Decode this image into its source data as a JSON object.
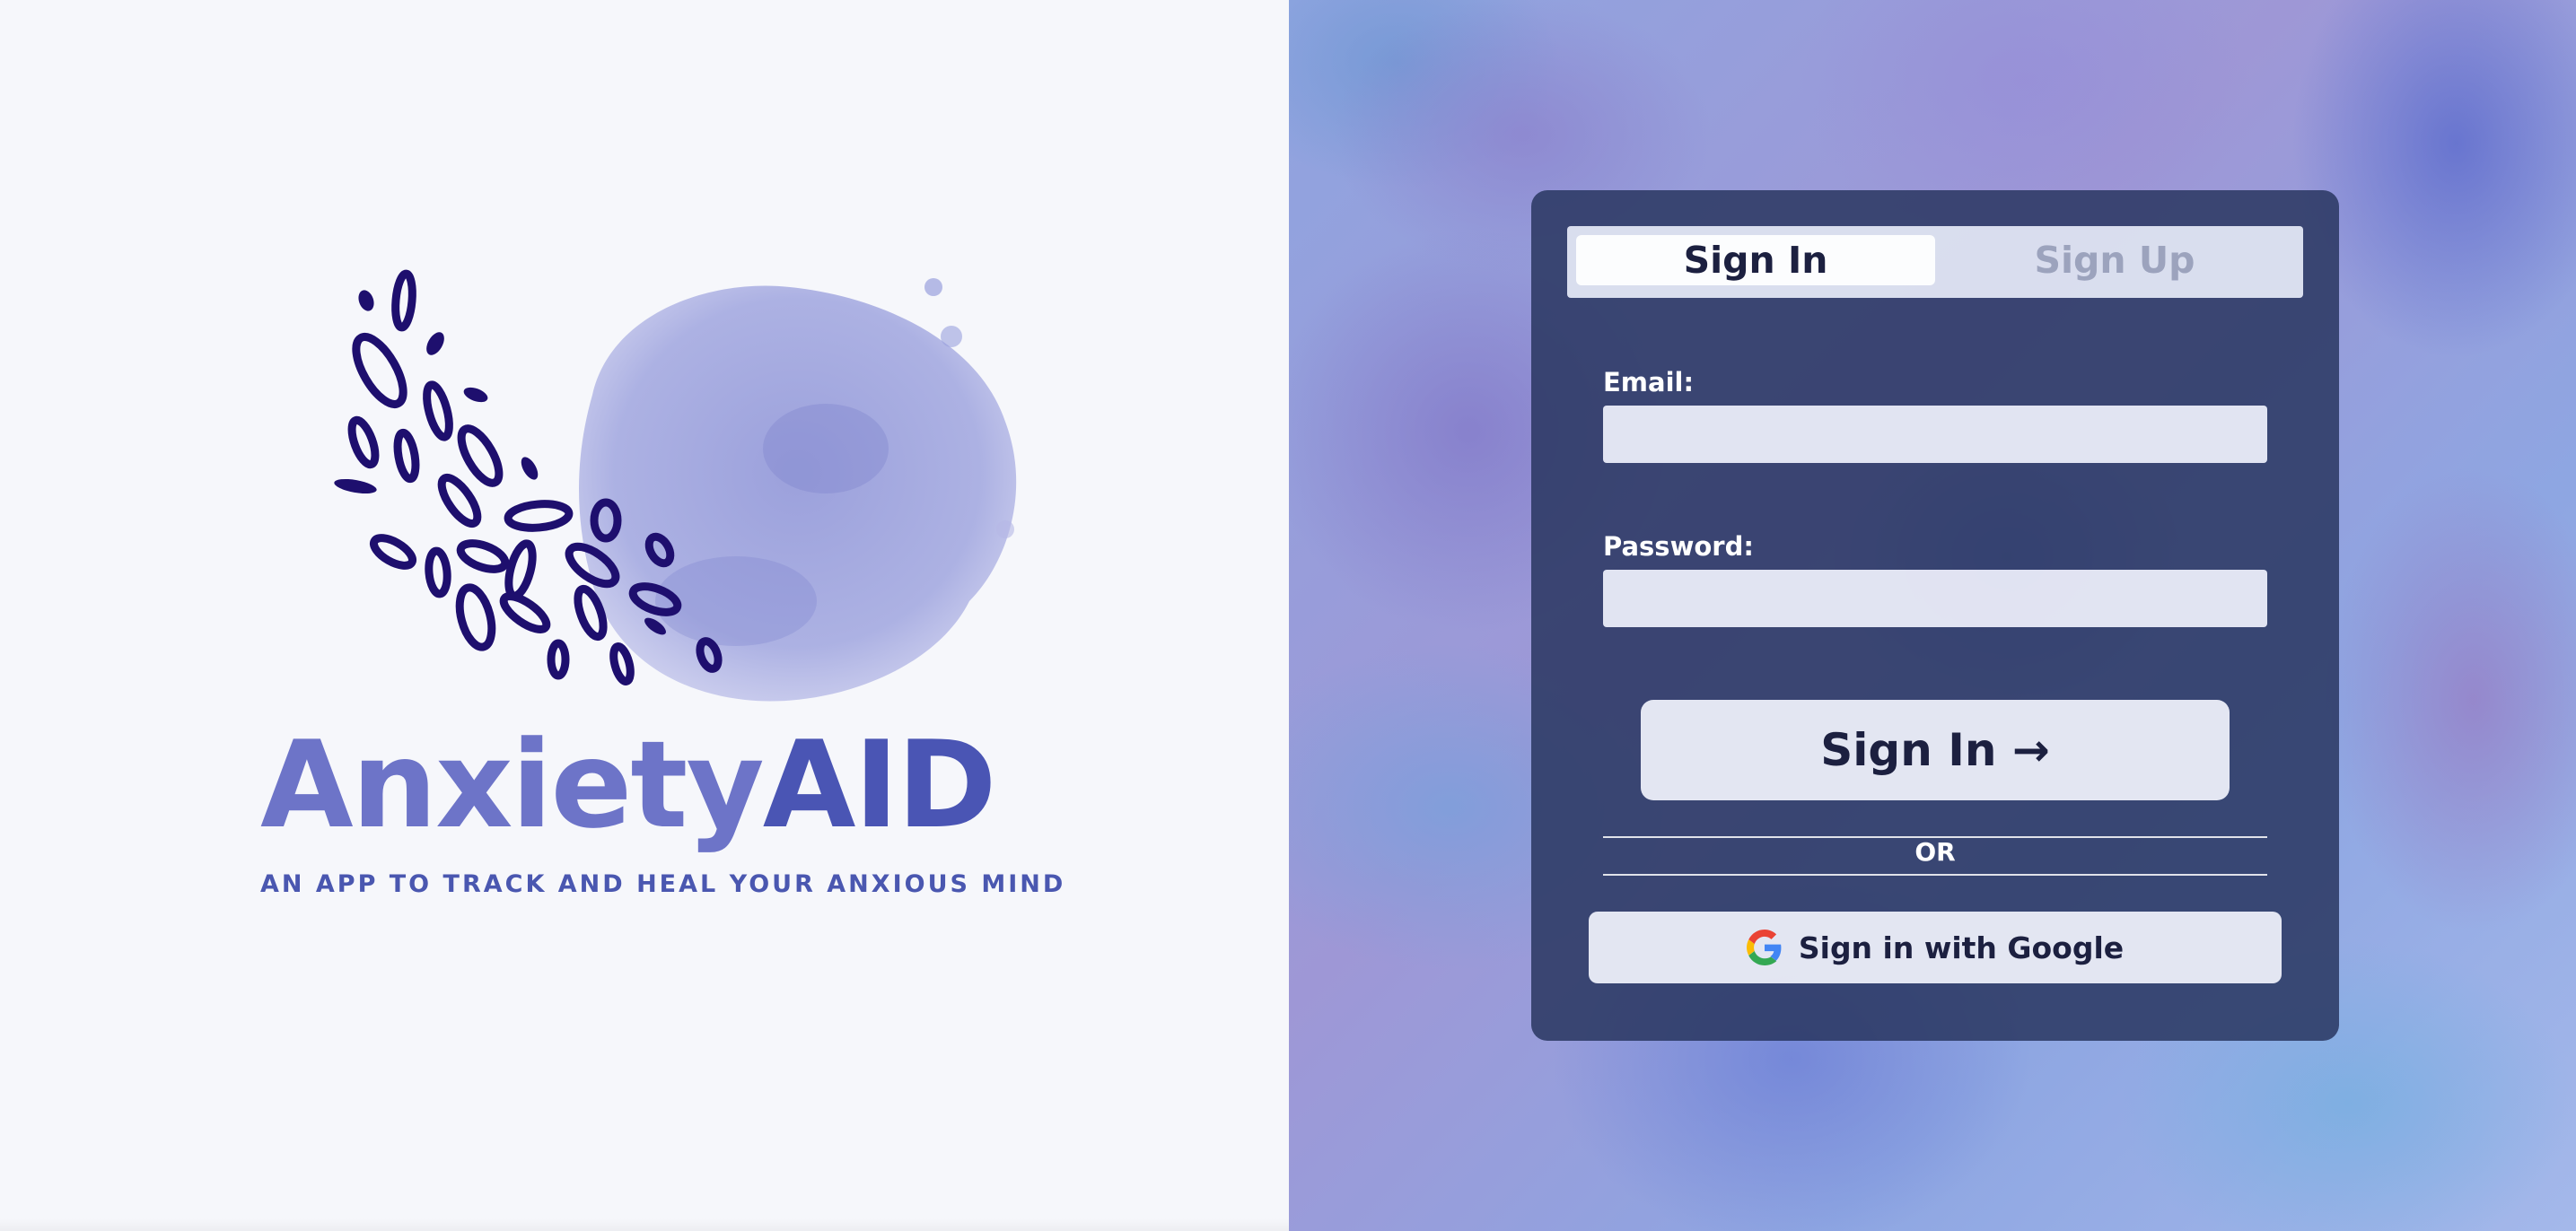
{
  "brand": {
    "name_part1": "Anxiety",
    "name_part2": "AID",
    "tagline": "AN APP TO TRACK AND HEAL YOUR ANXIOUS MIND",
    "colors": {
      "light": "#6d74c8",
      "dark": "#4a55b4",
      "petals": "#1e0f6e"
    }
  },
  "auth": {
    "tabs": [
      {
        "label": "Sign In",
        "active": true
      },
      {
        "label": "Sign Up",
        "active": false
      }
    ],
    "email": {
      "label": "Email:",
      "value": "",
      "placeholder": ""
    },
    "password": {
      "label": "Password:",
      "value": "",
      "placeholder": ""
    },
    "submit_label": "Sign In →",
    "divider_text": "OR",
    "google_label": "Sign in with Google",
    "google_icon": "google-g-icon"
  }
}
